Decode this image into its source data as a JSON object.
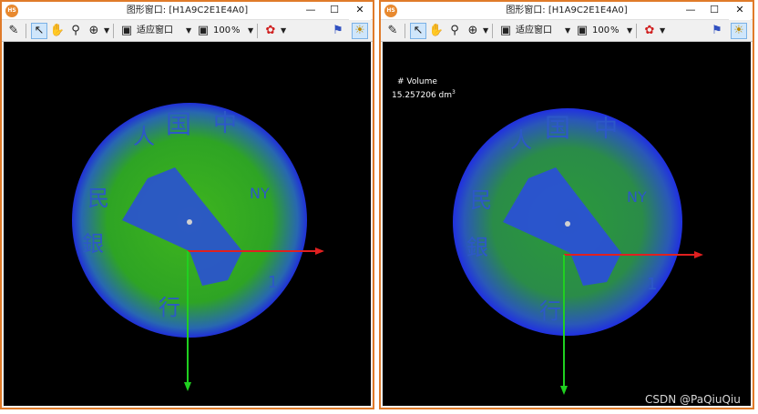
{
  "windows": [
    {
      "title": "图形窗口: [H1A9C2E1E4A0]",
      "app_logo": "HS",
      "controls": {
        "minimize": "—",
        "maximize": "☐",
        "close": "✕"
      },
      "toolbar": {
        "fit_mode": "适应窗口",
        "zoom": "100",
        "zoom_unit": "%"
      },
      "overlay_text": null
    },
    {
      "title": "图形窗口: [H1A9C2E1E4A0]",
      "app_logo": "HS",
      "controls": {
        "minimize": "—",
        "maximize": "☐",
        "close": "✕"
      },
      "toolbar": {
        "fit_mode": "适应窗口",
        "zoom": "100",
        "zoom_unit": "%"
      },
      "overlay_text": {
        "heading": "# Volume",
        "value": "15.257206 dm",
        "unit_sup": "3"
      }
    }
  ],
  "icons": [
    "pen-icon",
    "pointer-icon",
    "hand-icon",
    "magnifier-icon",
    "zoom-icon",
    "fit-window-icon",
    "zoom-percent-icon",
    "color-brush-icon",
    "camera-pin-icon",
    "lightbulb-icon"
  ],
  "colors": {
    "window_border": "#e07b2a",
    "axis_x": "#e02020",
    "axis_y": "#20d020",
    "coin_green": "#2aa820",
    "coin_blue": "#2a48d8"
  },
  "watermark": "CSDN @PaQiuQiu"
}
